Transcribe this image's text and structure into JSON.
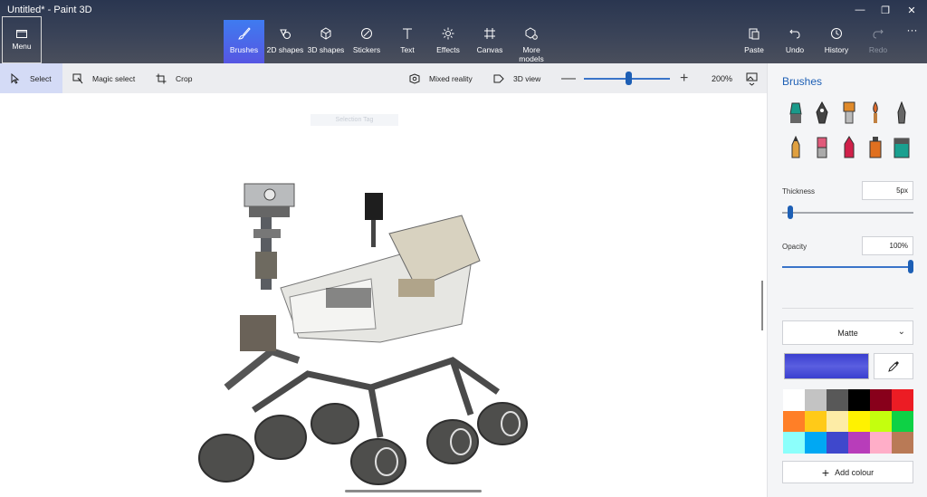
{
  "app": {
    "title": "Untitled* - Paint 3D"
  },
  "window_controls": {
    "minimize": "—",
    "maximize": "❐",
    "close": "✕"
  },
  "menu": {
    "label": "Menu"
  },
  "tools": [
    {
      "label": "Brushes",
      "icon": "brush-icon",
      "active": true
    },
    {
      "label": "2D shapes",
      "icon": "2d-shapes-icon"
    },
    {
      "label": "3D shapes",
      "icon": "3d-shapes-icon"
    },
    {
      "label": "Stickers",
      "icon": "stickers-icon"
    },
    {
      "label": "Text",
      "icon": "text-icon"
    },
    {
      "label": "Effects",
      "icon": "effects-icon"
    },
    {
      "label": "Canvas",
      "icon": "canvas-icon"
    },
    {
      "label": "More models",
      "icon": "more-models-icon"
    }
  ],
  "right_tools": [
    {
      "label": "Paste",
      "icon": "paste-icon"
    },
    {
      "label": "Undo",
      "icon": "undo-icon"
    },
    {
      "label": "History",
      "icon": "history-icon"
    },
    {
      "label": "Redo",
      "icon": "redo-icon",
      "disabled": true
    }
  ],
  "more_button": "···",
  "toolbar2": {
    "select": "Select",
    "magic_select": "Magic select",
    "crop": "Crop",
    "mixed_reality": "Mixed reality",
    "view_3d": "3D view",
    "zoom_minus": "—",
    "zoom_plus": "+",
    "zoom_value": "200%",
    "zoom_level": 0.5
  },
  "canvas": {
    "selection_tag": "Selection Tag"
  },
  "panel": {
    "title": "Brushes",
    "brushes": [
      {
        "name": "marker",
        "color": "#1a9a8a"
      },
      {
        "name": "calligraphy-pen",
        "color": "#444"
      },
      {
        "name": "oil-brush",
        "color": "#e08a2a"
      },
      {
        "name": "watercolor",
        "color": "#e06a2a"
      },
      {
        "name": "pixel-pen",
        "color": "#555"
      },
      {
        "name": "pencil",
        "color": "#e0a040"
      },
      {
        "name": "eraser",
        "color": "#e05a7a"
      },
      {
        "name": "crayon",
        "color": "#d0204a"
      },
      {
        "name": "spray-can",
        "color": "#e07020"
      },
      {
        "name": "fill",
        "color": "#1aa090"
      }
    ],
    "thickness_label": "Thickness",
    "thickness_value": "5px",
    "thickness_level": 0.05,
    "opacity_label": "Opacity",
    "opacity_value": "100%",
    "opacity_level": 1.0,
    "finish": "Matte",
    "current_color": "#4a4fd8",
    "palette": [
      "#ffffff",
      "#c3c3c3",
      "#585858",
      "#000000",
      "#88001b",
      "#ec1c24",
      "#ff7f27",
      "#ffca18",
      "#fdeca6",
      "#fff200",
      "#c4ff0e",
      "#0ed145",
      "#8cfffb",
      "#00a8f3",
      "#3f48cc",
      "#b83dba",
      "#ffaec8",
      "#b97a56"
    ],
    "add_colour": "Add colour"
  }
}
